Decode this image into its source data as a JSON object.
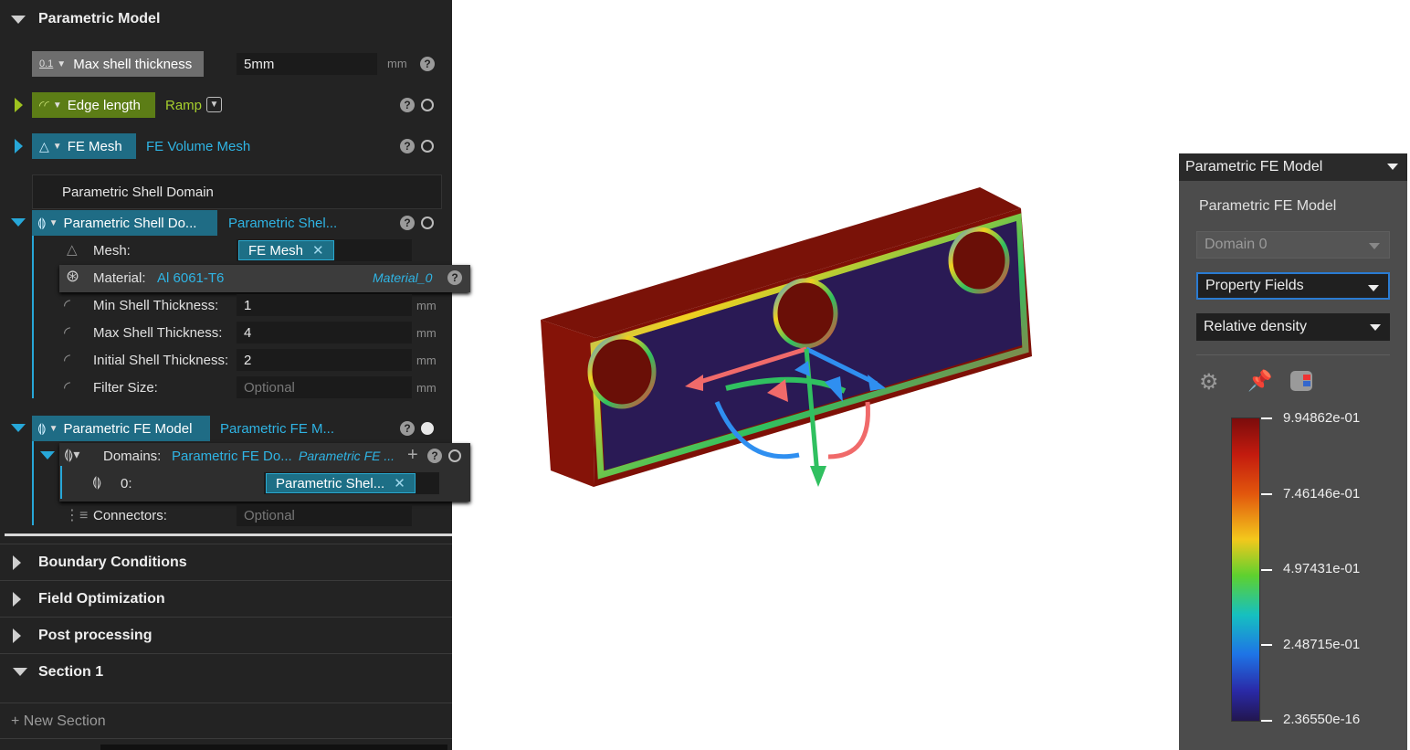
{
  "param_model": {
    "title": "Parametric Model"
  },
  "max_shell": {
    "badge": "0.1",
    "label": "Max shell thickness",
    "value": "5mm",
    "unit": "mm",
    "help": "?"
  },
  "edge_length": {
    "label": "Edge length",
    "value": "Ramp",
    "help": "?"
  },
  "fe_mesh": {
    "label": "FE Mesh",
    "value": "FE Volume Mesh",
    "help": "?"
  },
  "shell_domain": {
    "heading": "Parametric Shell Domain",
    "label": "Parametric Shell Do...",
    "value": "Parametric Shel...",
    "help": "?",
    "mesh_label": "Mesh:",
    "mesh_value": "FE Mesh",
    "material_label": "Material:",
    "material_value": "Al 6061-T6",
    "material_ref": "Material_0",
    "min_label": "Min Shell Thickness:",
    "min_value": "1",
    "max_label": "Max Shell Thickness:",
    "max_value": "4",
    "init_label": "Initial Shell Thickness:",
    "init_value": "2",
    "filter_label": "Filter Size:",
    "filter_placeholder": "Optional",
    "unit": "mm"
  },
  "fe_model": {
    "label": "Parametric FE Model",
    "value": "Parametric FE M...",
    "help": "?",
    "domains_label": "Domains:",
    "domains_value1": "Parametric FE Do...",
    "domains_value2": "Parametric FE ...",
    "add": "+",
    "item_index": "0:",
    "item_value": "Parametric Shel...",
    "connectors_label": "Connectors:",
    "connectors_placeholder": "Optional"
  },
  "sections": [
    {
      "label": "Boundary Conditions"
    },
    {
      "label": "Field Optimization"
    },
    {
      "label": "Post processing"
    },
    {
      "label": "Section 1"
    }
  ],
  "new_section": "+ New Section",
  "right_panel": {
    "title": "Parametric FE Model",
    "subtitle": "Parametric FE Model",
    "domain": "Domain 0",
    "mode": "Property Fields",
    "field": "Relative density",
    "legend": [
      "9.94862e-01",
      "7.46146e-01",
      "4.97431e-01",
      "2.48715e-01",
      "2.36550e-16"
    ]
  },
  "colors": {
    "accent_blue": "#27a7d8",
    "accent_green": "#9dc21f",
    "panel_dark": "#232323"
  }
}
